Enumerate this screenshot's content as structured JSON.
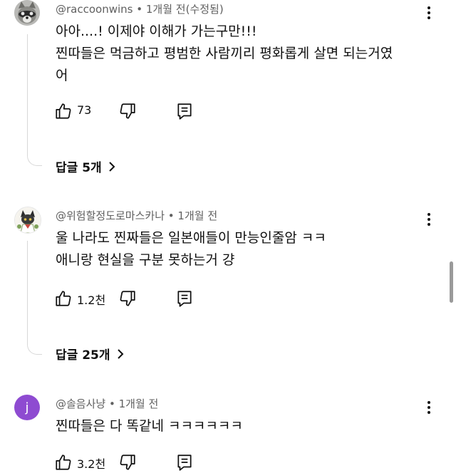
{
  "comments": [
    {
      "author": "@raccoonwins",
      "time": "1개월 전",
      "edited": "(수정됨)",
      "text": "아아....! 이제야 이해가 가는구만!!!\n찐따들은 먹금하고 평범한 사람끼리 평화롭게 살면 되는거였\n어",
      "likes": "73",
      "replies_label": "답글 5개",
      "avatar": "raccoon-avatar"
    },
    {
      "author": "@위험할정도로마스카나",
      "time": "1개월 전",
      "edited": "",
      "text": "울 나라도 찐짜들은 일본애들이 만능인줄암 ㅋㅋ\n애니랑 현실을 구분 못하는거 걍",
      "likes": "1.2천",
      "replies_label": "답글 25개",
      "avatar": "anime-avatar"
    },
    {
      "author": "@솔음사냥",
      "time": "1개월 전",
      "edited": "",
      "text": "찐따들은 다 똑같네 ㅋㅋㅋㅋㅋㅋ",
      "likes": "3.2천",
      "replies_label": "",
      "avatar_letter": "j",
      "avatar_color": "#8e4bd1"
    }
  ],
  "separator": " • ",
  "colors": {
    "meta": "#606060",
    "text": "#0f0f0f",
    "thread": "#d8d8d8"
  }
}
